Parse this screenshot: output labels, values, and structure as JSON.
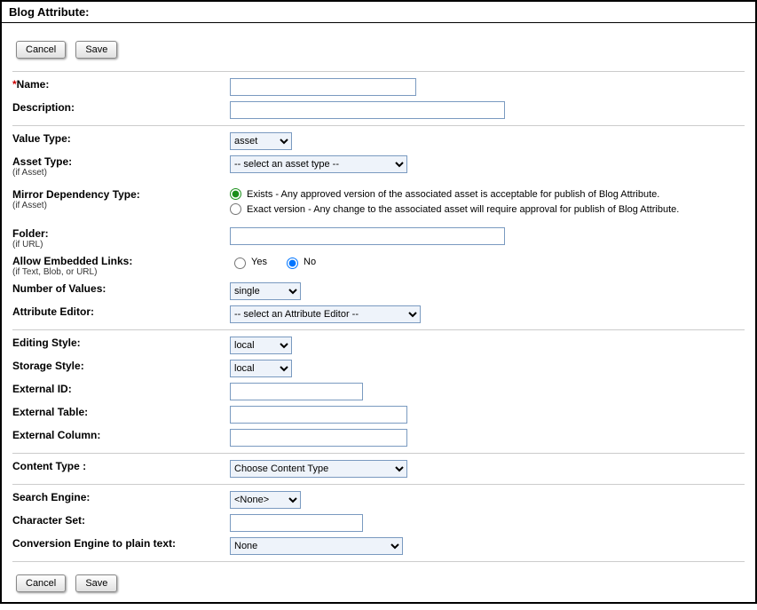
{
  "title": "Blog Attribute:",
  "buttons": {
    "cancel": "Cancel",
    "save": "Save"
  },
  "fields": {
    "name": {
      "label": "Name:",
      "value": ""
    },
    "description": {
      "label": "Description:",
      "value": ""
    },
    "valueType": {
      "label": "Value Type:",
      "value": "asset",
      "options": [
        "asset"
      ]
    },
    "assetType": {
      "label": "Asset Type:",
      "sub": "(if Asset)",
      "value": "-- select an asset type --",
      "options": [
        "-- select an asset type --"
      ]
    },
    "mirrorDep": {
      "label": "Mirror Dependency Type:",
      "sub": "(if Asset)",
      "exists": {
        "label": "Exists - Any approved version of the associated asset is acceptable for publish of Blog Attribute.",
        "checked": true
      },
      "exact": {
        "label": "Exact version - Any change to the associated asset will require approval for publish of Blog Attribute.",
        "checked": false
      }
    },
    "folder": {
      "label": "Folder:",
      "sub": "(if URL)",
      "value": ""
    },
    "allowEmbedded": {
      "label": "Allow Embedded Links:",
      "sub": "(if Text, Blob, or URL)",
      "yes": "Yes",
      "no": "No",
      "selected": "no"
    },
    "numValues": {
      "label": "Number of Values:",
      "value": "single",
      "options": [
        "single"
      ]
    },
    "attrEditor": {
      "label": "Attribute Editor:",
      "value": "-- select an Attribute Editor --",
      "options": [
        "-- select an Attribute Editor --"
      ]
    },
    "editingStyle": {
      "label": "Editing Style:",
      "value": "local",
      "options": [
        "local"
      ]
    },
    "storageStyle": {
      "label": "Storage Style:",
      "value": "local",
      "options": [
        "local"
      ]
    },
    "externalId": {
      "label": "External ID:",
      "value": ""
    },
    "externalTable": {
      "label": "External Table:",
      "value": ""
    },
    "externalColumn": {
      "label": "External Column:",
      "value": ""
    },
    "contentType": {
      "label": "Content Type :",
      "value": "Choose Content Type",
      "options": [
        "Choose Content Type"
      ]
    },
    "searchEngine": {
      "label": "Search Engine:",
      "value": "<None>",
      "options": [
        "<None>"
      ]
    },
    "charSet": {
      "label": "Character Set:",
      "value": ""
    },
    "convEngine": {
      "label": "Conversion Engine to plain text:",
      "value": "None",
      "options": [
        "None"
      ]
    }
  }
}
